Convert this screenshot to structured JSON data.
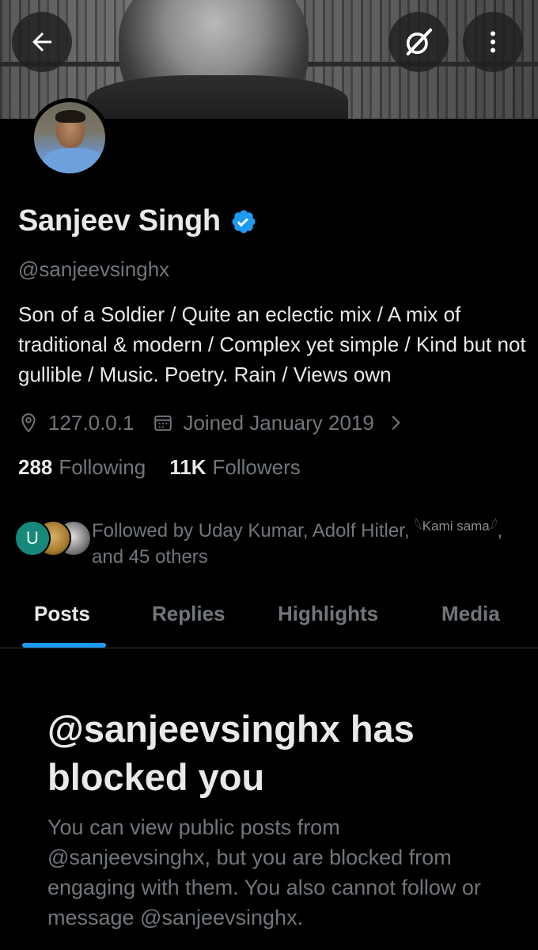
{
  "header": {
    "back_icon": "arrow-left-icon",
    "grok_icon": "grok-icon",
    "more_icon": "more-vertical-icon"
  },
  "profile": {
    "name": "Sanjeev Singh",
    "verified_color": "#1d9bf0",
    "handle": "@sanjeevsinghx",
    "bio": "Son of a Soldier / Quite an eclectic mix / A mix of traditional & modern / Complex yet simple / Kind but not gullible / Music. Poetry. Rain / Views own",
    "location": "127.0.0.1",
    "joined": "Joined January 2019",
    "following_count": "288",
    "following_label": "Following",
    "followers_count": "11K",
    "followers_label": "Followers"
  },
  "followed_by": {
    "avatar_initial": "U",
    "text_start": "Followed by Uday Kumar, Adolf Hitler, ",
    "kami_name": "𓆩Kami sama𓆪",
    "text_end": ", and 45 others"
  },
  "tabs": [
    {
      "label": "Posts",
      "active": true
    },
    {
      "label": "Replies",
      "active": false
    },
    {
      "label": "Highlights",
      "active": false
    },
    {
      "label": "Media",
      "active": false
    }
  ],
  "blocked": {
    "title": "@sanjeevsinghx has blocked you",
    "description": "You can view public posts from @sanjeevsinghx, but you are blocked from engaging with them. You also cannot follow or message @sanjeevsinghx."
  },
  "colors": {
    "accent": "#1d9bf0",
    "background": "#000000",
    "secondary_text": "#71767b"
  }
}
